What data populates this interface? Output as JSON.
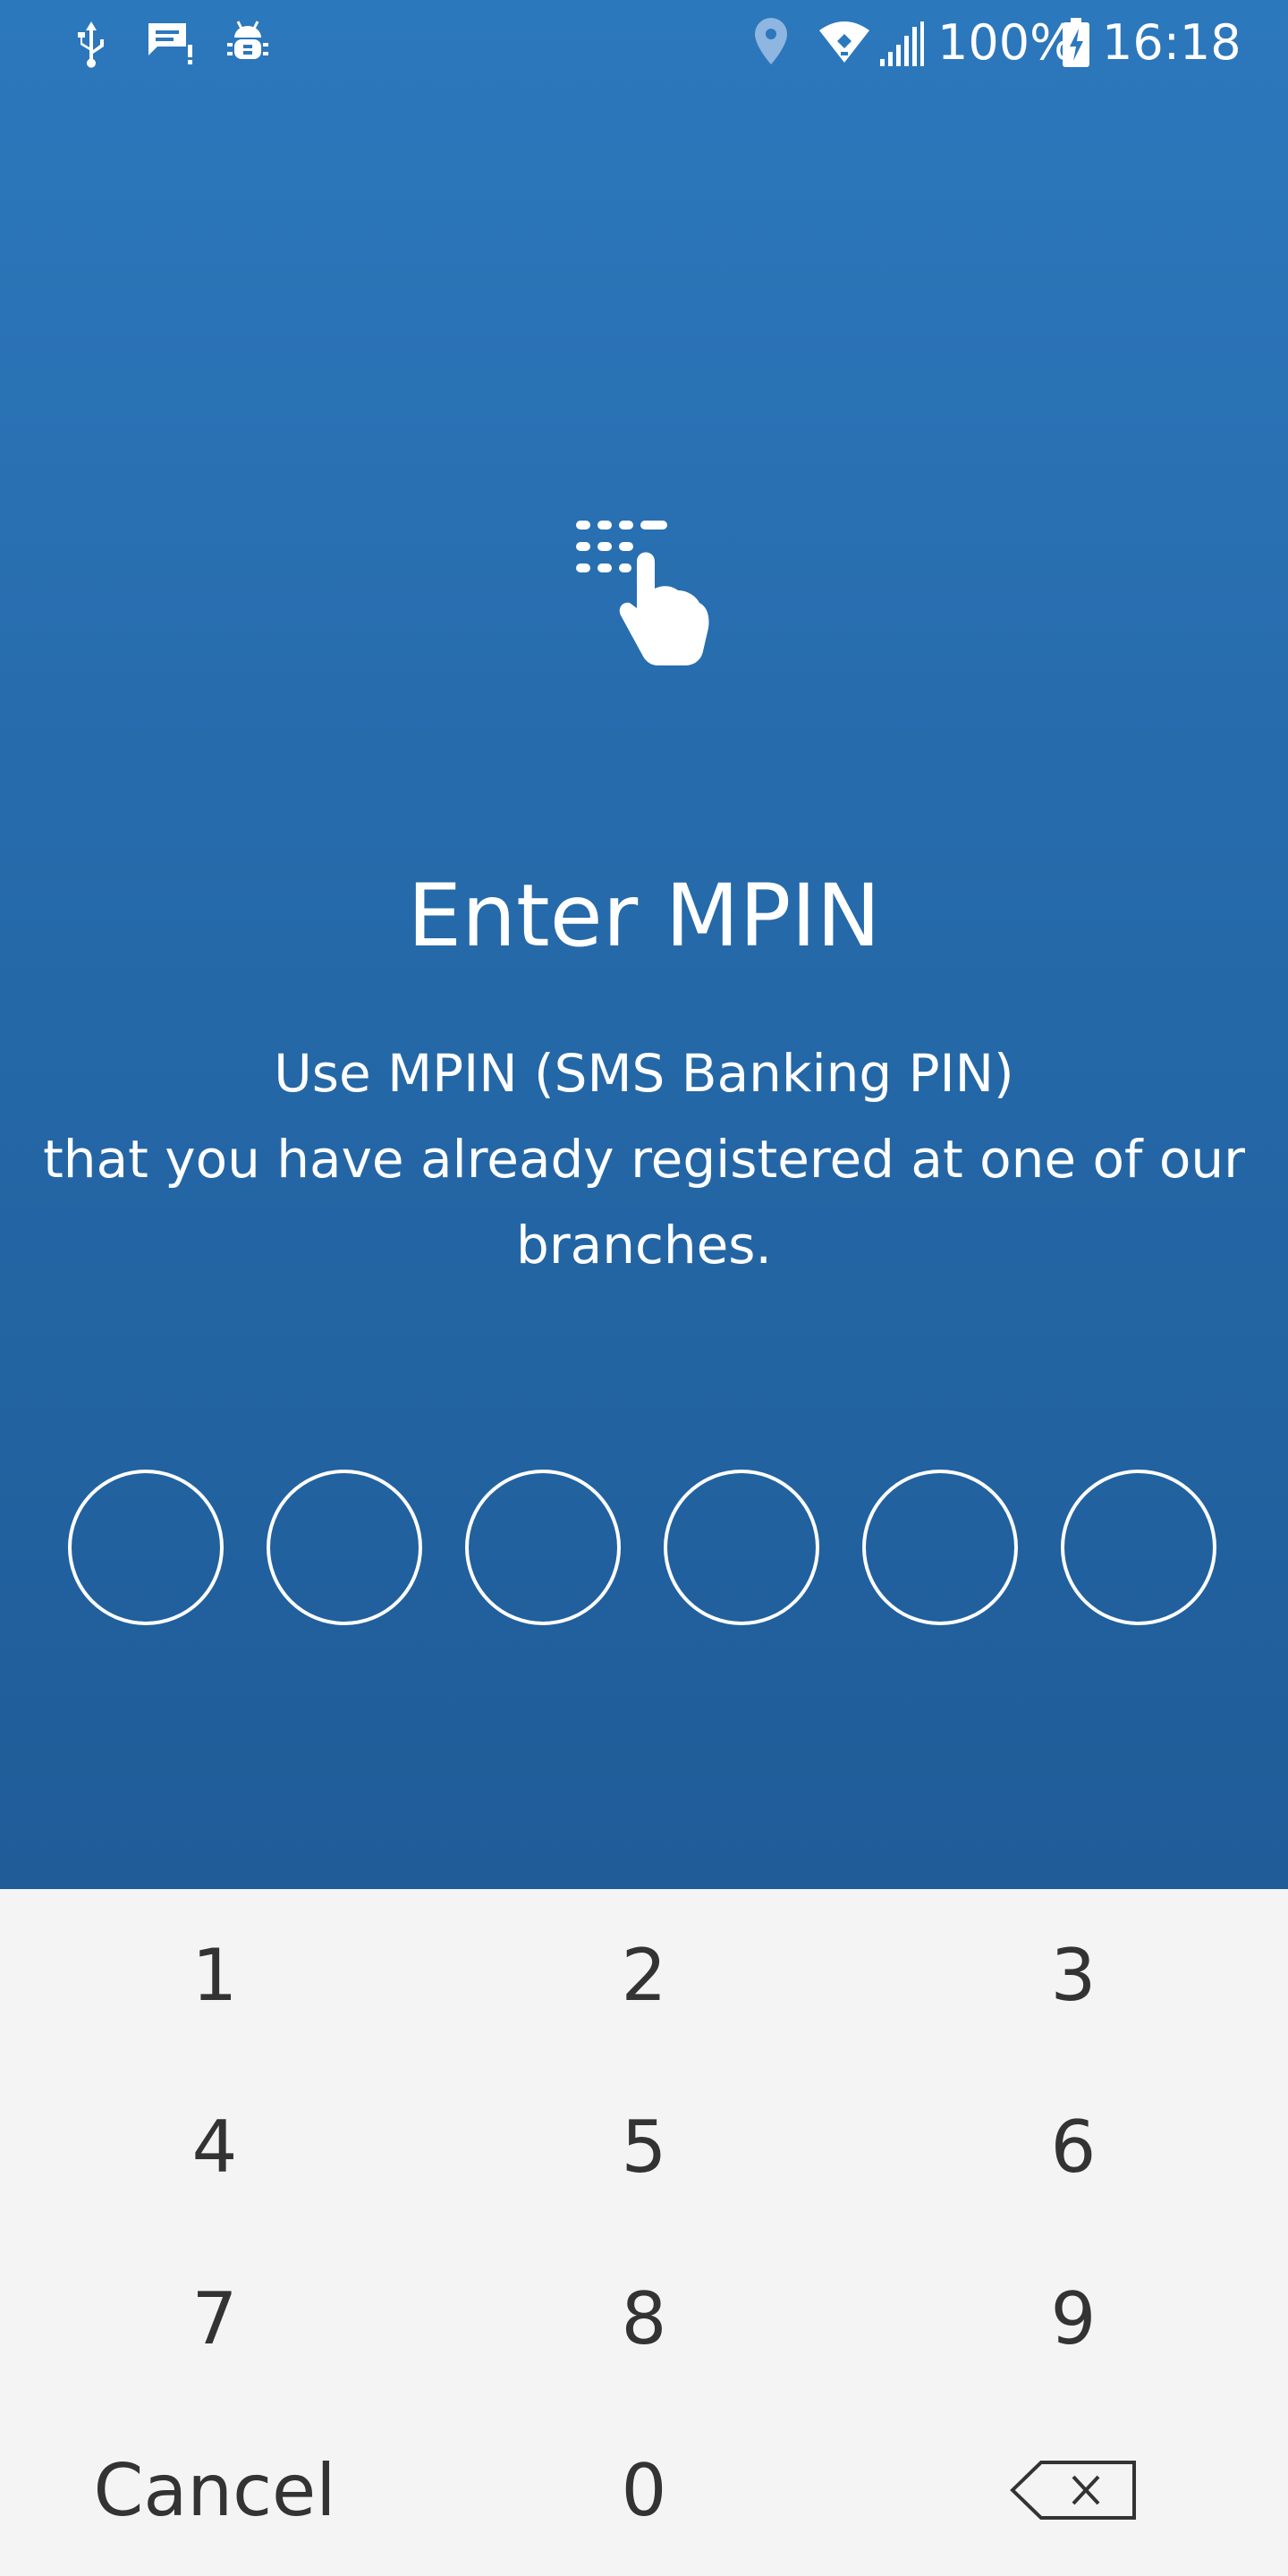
{
  "status_bar": {
    "battery_percent": "100%",
    "time": "16:18",
    "left_icons": [
      "usb-icon",
      "message-alert-icon",
      "android-debug-icon"
    ],
    "right_icons": [
      "location-icon",
      "wifi-icon",
      "signal-icon",
      "battery-charging-icon"
    ]
  },
  "hero": {
    "icon": "keypad-touch-icon"
  },
  "title": "Enter MPIN",
  "description": {
    "line1": "Use MPIN (SMS Banking PIN)",
    "line2": "that you have already registered at one of our",
    "line3": "branches."
  },
  "pin": {
    "length": 6,
    "filled": 0
  },
  "keypad": {
    "keys": [
      "1",
      "2",
      "3",
      "4",
      "5",
      "6",
      "7",
      "8",
      "9"
    ],
    "cancel_label": "Cancel",
    "zero": "0",
    "backspace_icon": "backspace-icon"
  },
  "colors": {
    "header_top": "#2c78bc",
    "header_bottom": "#1f5c98",
    "keypad_bg": "#f4f4f4",
    "key_text": "#333333"
  }
}
